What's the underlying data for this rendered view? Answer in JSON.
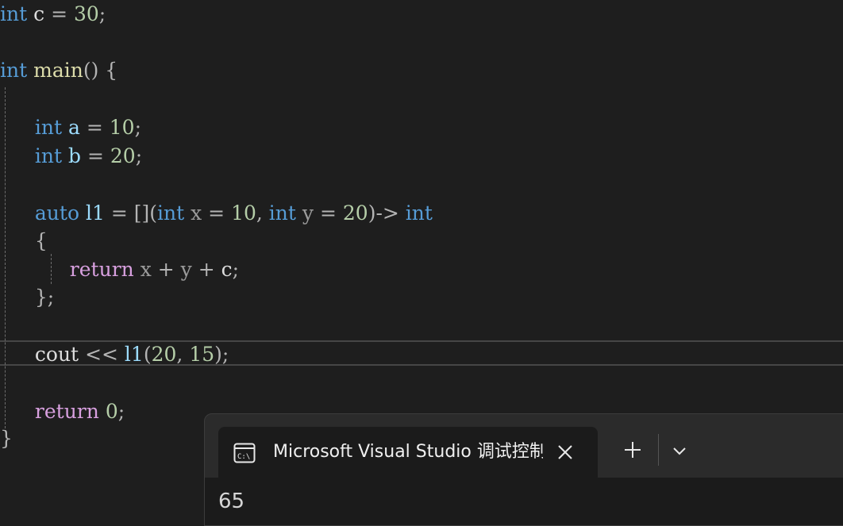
{
  "editor": {
    "line1": {
      "type": "int",
      "name": "c",
      "eq": "=",
      "value": "30",
      "semi": ";"
    },
    "line2": {
      "type": "int",
      "name": "main",
      "parens": "()",
      "brace": "{"
    },
    "line3": {
      "type": "int",
      "name": "a",
      "eq": "=",
      "value": "10",
      "semi": ";"
    },
    "line4": {
      "type": "int",
      "name": "b",
      "eq": "=",
      "value": "20",
      "semi": ";"
    },
    "line5": {
      "auto": "auto",
      "name": "l1",
      "eq": "=",
      "capture": "[](",
      "p1_type": "int",
      "p1_name": "x",
      "p1_eq": "=",
      "p1_val": "10",
      "comma": ",",
      "p2_type": "int",
      "p2_name": "y",
      "p2_eq": "=",
      "p2_val": "20",
      "arrow": ")->",
      "ret_type": "int"
    },
    "line6": {
      "brace": "{"
    },
    "line7": {
      "ret": "return",
      "x": "x",
      "plus1": "+",
      "y": "y",
      "plus2": "+",
      "c": "c",
      "semi": ";"
    },
    "line8": {
      "close": "};"
    },
    "line9": {
      "cout": "cout",
      "op": "<<",
      "fn": "l1",
      "open": "(",
      "a1": "20",
      "comma": ",",
      "a2": "15",
      "close": ");"
    },
    "line10": {
      "ret": "return",
      "val": "0",
      "semi": ";"
    },
    "line11": {
      "brace": "}"
    }
  },
  "terminal": {
    "tab_title": "Microsoft Visual Studio 调试控制台",
    "tab_icon": "console-icon",
    "close_icon": "close-icon",
    "new_tab_icon": "plus-icon",
    "dropdown_icon": "chevron-down-icon",
    "output": "65"
  }
}
